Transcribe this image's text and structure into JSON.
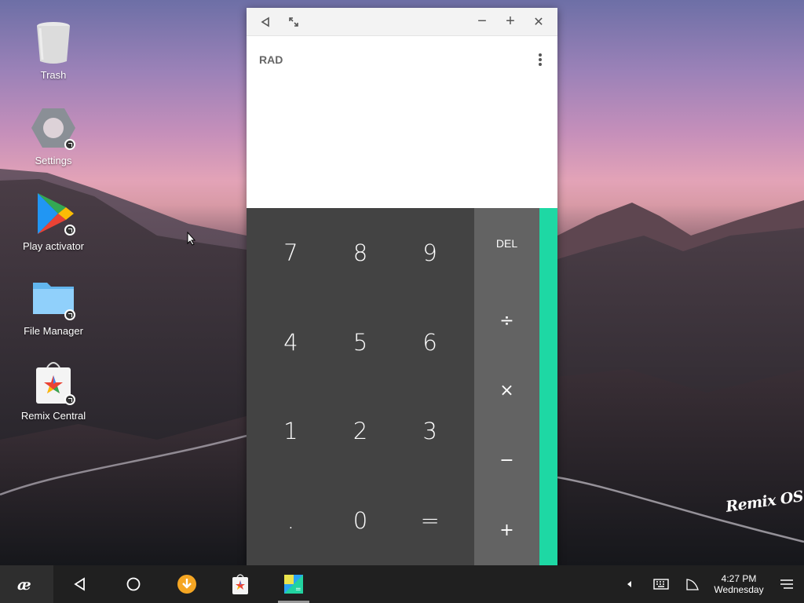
{
  "desktop": {
    "icons": [
      {
        "label": "Trash",
        "icon": "trash-icon"
      },
      {
        "label": "Settings",
        "icon": "settings-icon"
      },
      {
        "label": "Play activator",
        "icon": "play-store-icon"
      },
      {
        "label": "File Manager",
        "icon": "folder-icon"
      },
      {
        "label": "Remix Central",
        "icon": "remix-central-icon"
      }
    ],
    "watermark": "Remix OS"
  },
  "calculator": {
    "titlebar": {
      "back": "◁",
      "restore": "⤢",
      "minimize": "−",
      "maximize": "+",
      "close": "✕"
    },
    "mode_label": "RAD",
    "digits": [
      "7",
      "8",
      "9",
      "4",
      "5",
      "6",
      "1",
      "2",
      "3",
      ".",
      "0",
      "="
    ],
    "operators": {
      "del": "DEL",
      "divide": "÷",
      "multiply": "×",
      "minus": "−",
      "plus": "+"
    },
    "accent_color": "#1ed8a4"
  },
  "taskbar": {
    "clock_time": "4:27 PM",
    "clock_day": "Wednesday"
  }
}
